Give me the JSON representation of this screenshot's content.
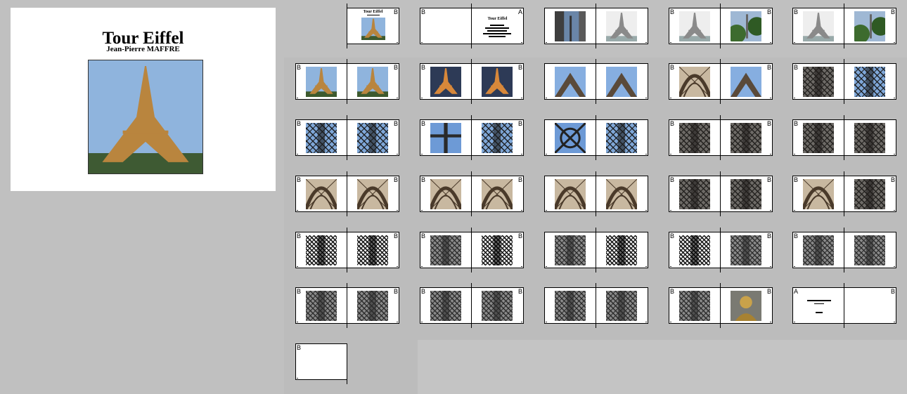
{
  "cover": {
    "title": "Tour Eiffel",
    "author": "Jean-Pierre MAFFRE",
    "photo_icon": "eiffel-tower-photo"
  },
  "spreads": [
    {
      "left": null,
      "right": {
        "label": "B",
        "kind": "title",
        "title": "Tour Eiffel",
        "photo": "eiffel-day"
      }
    },
    {
      "left": {
        "label": "B",
        "kind": "blank"
      },
      "right": {
        "label": "A",
        "kind": "text",
        "title": "Tour Eiffel"
      }
    },
    {
      "left": {
        "label": "",
        "kind": "photo",
        "photo": "tower-buildings"
      },
      "right": {
        "label": "",
        "kind": "photo",
        "photo": "tower-gray"
      }
    },
    {
      "left": {
        "label": "B",
        "kind": "photo",
        "photo": "tower-gray"
      },
      "right": {
        "label": "B",
        "kind": "photo",
        "photo": "tower-trees"
      }
    },
    {
      "left": {
        "label": "B",
        "kind": "photo",
        "photo": "tower-gray"
      },
      "right": {
        "label": "B",
        "kind": "photo",
        "photo": "tower-trees"
      }
    },
    {
      "left": {
        "label": "B",
        "kind": "photo",
        "photo": "eiffel-day"
      },
      "right": {
        "label": "B",
        "kind": "photo",
        "photo": "eiffel-day"
      }
    },
    {
      "left": {
        "label": "B",
        "kind": "photo",
        "photo": "eiffel-dusk"
      },
      "right": {
        "label": "B",
        "kind": "photo",
        "photo": "eiffel-dusk"
      }
    },
    {
      "left": {
        "label": "",
        "kind": "photo",
        "photo": "under-sky"
      },
      "right": {
        "label": "",
        "kind": "photo",
        "photo": "under-sky"
      }
    },
    {
      "left": {
        "label": "B",
        "kind": "photo",
        "photo": "arch-bronze"
      },
      "right": {
        "label": "B",
        "kind": "photo",
        "photo": "under-sky"
      }
    },
    {
      "left": {
        "label": "B",
        "kind": "photo",
        "photo": "lattice-dark"
      },
      "right": {
        "label": "",
        "kind": "photo",
        "photo": "lattice-blue"
      }
    },
    {
      "left": {
        "label": "B",
        "kind": "photo",
        "photo": "lattice-blue"
      },
      "right": {
        "label": "B",
        "kind": "photo",
        "photo": "lattice-blue"
      }
    },
    {
      "left": {
        "label": "B",
        "kind": "photo",
        "photo": "cross-blue"
      },
      "right": {
        "label": "B",
        "kind": "photo",
        "photo": "lattice-blue"
      }
    },
    {
      "left": {
        "label": "",
        "kind": "photo",
        "photo": "wheel-blue"
      },
      "right": {
        "label": "",
        "kind": "photo",
        "photo": "lattice-blue"
      }
    },
    {
      "left": {
        "label": "B",
        "kind": "photo",
        "photo": "lattice-dark"
      },
      "right": {
        "label": "B",
        "kind": "photo",
        "photo": "lattice-dark"
      }
    },
    {
      "left": {
        "label": "B",
        "kind": "photo",
        "photo": "lattice-dark"
      },
      "right": {
        "label": "",
        "kind": "photo",
        "photo": "lattice-dark"
      }
    },
    {
      "left": {
        "label": "B",
        "kind": "photo",
        "photo": "arch-bronze"
      },
      "right": {
        "label": "B",
        "kind": "photo",
        "photo": "arch-bronze"
      }
    },
    {
      "left": {
        "label": "B",
        "kind": "photo",
        "photo": "arch-bronze"
      },
      "right": {
        "label": "B",
        "kind": "photo",
        "photo": "arch-bronze"
      }
    },
    {
      "left": {
        "label": "",
        "kind": "photo",
        "photo": "arch-bronze"
      },
      "right": {
        "label": "",
        "kind": "photo",
        "photo": "arch-bronze"
      }
    },
    {
      "left": {
        "label": "B",
        "kind": "photo",
        "photo": "lattice-dark"
      },
      "right": {
        "label": "B",
        "kind": "photo",
        "photo": "lattice-dark"
      }
    },
    {
      "left": {
        "label": "B",
        "kind": "photo",
        "photo": "arch-bronze"
      },
      "right": {
        "label": "B",
        "kind": "photo",
        "photo": "lattice-dark"
      }
    },
    {
      "left": {
        "label": "B",
        "kind": "photo",
        "photo": "lattice-bw"
      },
      "right": {
        "label": "B",
        "kind": "photo",
        "photo": "lattice-bw"
      }
    },
    {
      "left": {
        "label": "B",
        "kind": "photo",
        "photo": "lattice-gray"
      },
      "right": {
        "label": "B",
        "kind": "photo",
        "photo": "lattice-bw"
      }
    },
    {
      "left": {
        "label": "",
        "kind": "photo",
        "photo": "lattice-gray"
      },
      "right": {
        "label": "",
        "kind": "photo",
        "photo": "lattice-bw"
      }
    },
    {
      "left": {
        "label": "B",
        "kind": "photo",
        "photo": "lattice-bw"
      },
      "right": {
        "label": "B",
        "kind": "photo",
        "photo": "lattice-gray"
      }
    },
    {
      "left": {
        "label": "B",
        "kind": "photo",
        "photo": "lattice-gray"
      },
      "right": {
        "label": "",
        "kind": "photo",
        "photo": "lattice-gray"
      }
    },
    {
      "left": {
        "label": "B",
        "kind": "photo",
        "photo": "lattice-gray"
      },
      "right": {
        "label": "B",
        "kind": "photo",
        "photo": "lattice-gray"
      }
    },
    {
      "left": {
        "label": "B",
        "kind": "photo",
        "photo": "lattice-gray"
      },
      "right": {
        "label": "B",
        "kind": "photo",
        "photo": "lattice-gray"
      }
    },
    {
      "left": {
        "label": "",
        "kind": "photo",
        "photo": "lattice-gray"
      },
      "right": {
        "label": "",
        "kind": "photo",
        "photo": "lattice-gray"
      }
    },
    {
      "left": {
        "label": "B",
        "kind": "photo",
        "photo": "lattice-gray"
      },
      "right": {
        "label": "B",
        "kind": "photo",
        "photo": "bust-gold"
      }
    },
    {
      "left": {
        "label": "A",
        "kind": "signature"
      },
      "right": {
        "label": "B",
        "kind": "blank"
      }
    },
    {
      "left": {
        "label": "B",
        "kind": "blank"
      },
      "right": null
    }
  ]
}
